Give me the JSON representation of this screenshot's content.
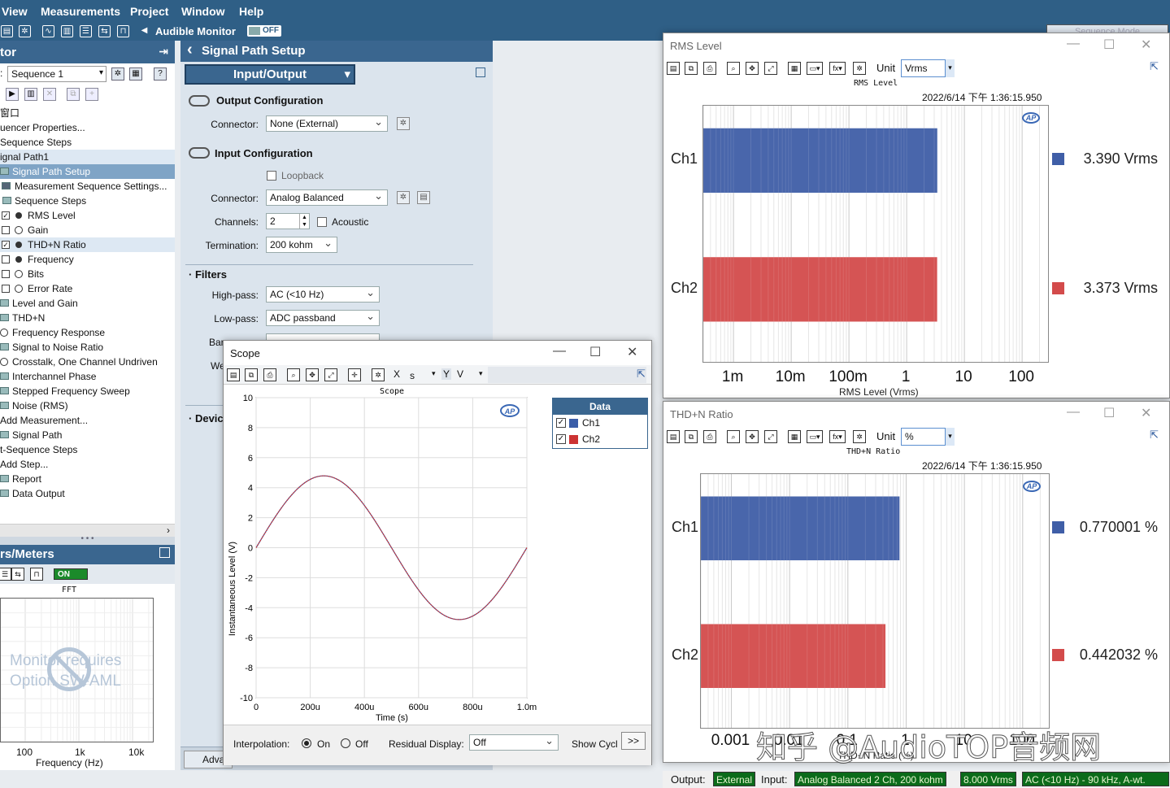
{
  "menu": [
    "View",
    "Measurements",
    "Project",
    "Window",
    "Help"
  ],
  "toolbar": {
    "audible_monitor": "Audible Monitor",
    "audible_state": "OFF",
    "sequence_mode": "Sequence Mode"
  },
  "navigator": {
    "title": "tor",
    "sequence": "Sequence 1",
    "tree": [
      {
        "text": "窗口",
        "indent": 0,
        "icon": "none"
      },
      {
        "text": "uencer Properties...",
        "indent": 0,
        "icon": "none"
      },
      {
        "text": "Sequence Steps",
        "indent": 0,
        "icon": "none"
      },
      {
        "text": "ignal Path1",
        "indent": 0,
        "icon": "none",
        "style": "sel"
      },
      {
        "text": "Signal Path Setup",
        "indent": 14,
        "icon": "fold",
        "style": "sel2"
      },
      {
        "text": "Measurement Sequence Settings...",
        "indent": 18,
        "icon": "gear"
      },
      {
        "text": "Sequence Steps",
        "indent": 18,
        "icon": "fold"
      },
      {
        "text": "RMS Level",
        "indent": 34,
        "icon": "chk-dot",
        "checked": true
      },
      {
        "text": "Gain",
        "indent": 34,
        "icon": "chk-ban"
      },
      {
        "text": "THD+N Ratio",
        "indent": 34,
        "icon": "chk-dot",
        "checked": true,
        "style": "sel"
      },
      {
        "text": "Frequency",
        "indent": 34,
        "icon": "chk-dot"
      },
      {
        "text": "Bits",
        "indent": 34,
        "icon": "chk-ban"
      },
      {
        "text": "Error Rate",
        "indent": 34,
        "icon": "chk-ban"
      },
      {
        "text": "Level and Gain",
        "indent": 15,
        "icon": "fold"
      },
      {
        "text": "THD+N",
        "indent": 15,
        "icon": "fold"
      },
      {
        "text": "Frequency Response",
        "indent": 15,
        "icon": "ban"
      },
      {
        "text": "Signal to Noise Ratio",
        "indent": 15,
        "icon": "fold"
      },
      {
        "text": "Crosstalk, One Channel Undriven",
        "indent": 15,
        "icon": "ban"
      },
      {
        "text": "Interchannel Phase",
        "indent": 15,
        "icon": "fold"
      },
      {
        "text": "Stepped Frequency Sweep",
        "indent": 15,
        "icon": "fold"
      },
      {
        "text": "Noise (RMS)",
        "indent": 15,
        "icon": "fold"
      },
      {
        "text": "Add Measurement...",
        "indent": 0,
        "icon": "none"
      },
      {
        "text": "Signal Path",
        "indent": 5,
        "icon": "fold"
      },
      {
        "text": "t-Sequence Steps",
        "indent": 0,
        "icon": "none"
      },
      {
        "text": "Add Step...",
        "indent": 0,
        "icon": "none"
      },
      {
        "text": "Report",
        "indent": 15,
        "icon": "fold"
      },
      {
        "text": "Data Output",
        "indent": 15,
        "icon": "fold"
      }
    ]
  },
  "meters": {
    "title": "rs/Meters",
    "state": "ON",
    "fft_title": "FFT",
    "message": "Monitor requires Option SW-AML",
    "x_ticks": [
      "100",
      "1k",
      "10k"
    ],
    "xlabel": "Frequency (Hz)"
  },
  "signal_path": {
    "title": "Signal Path Setup",
    "mode": "Input/Output",
    "output_config": "Output Configuration",
    "connector_label": "Connector:",
    "output_connector": "None (External)",
    "input_config": "Input Configuration",
    "loopback": "Loopback",
    "input_connector": "Analog Balanced",
    "channels_label": "Channels:",
    "channels": "2",
    "acoustic": "Acoustic",
    "termination_label": "Termination:",
    "termination": "200 kohm",
    "filters": "Filters",
    "highpass_label": "High-pass:",
    "highpass": "AC (<10 Hz)",
    "lowpass_label": "Low-pass:",
    "lowpass": "ADC passband",
    "bandwidth_label": "Bar",
    "bandwidth": "",
    "weighting_label": "We",
    "device": "Devic",
    "advanced": "Adva"
  },
  "scope": {
    "title": "Scope",
    "x_field": "X",
    "x_unit": "s",
    "y_field": "Y",
    "y_unit": "V",
    "legend_header": "Data",
    "interpolation_label": "Interpolation:",
    "interp_on": "On",
    "interp_off": "Off",
    "residual_label": "Residual Display:",
    "residual_value": "Off",
    "show_cycles": "Show Cycl",
    "more": ">>",
    "chart_data": {
      "type": "line",
      "title": "Scope",
      "xlabel": "Time (s)",
      "ylabel": "Instantaneous Level (V)",
      "xlim": [
        0,
        0.001
      ],
      "ylim": [
        -10,
        10
      ],
      "x_ticks": [
        "0",
        "200u",
        "400u",
        "600u",
        "800u",
        "1.0m"
      ],
      "y_ticks": [
        "10",
        "8",
        "6",
        "4",
        "2",
        "0",
        "-2",
        "-4",
        "-6",
        "-8",
        "-10"
      ],
      "waveform": {
        "amplitude": 4.79,
        "frequency_hz": 1000,
        "phase_deg": 0
      },
      "series": [
        {
          "name": "Ch1",
          "color": "#3a5da8"
        },
        {
          "name": "Ch2",
          "color": "#cc3333"
        }
      ]
    }
  },
  "rms_meter": {
    "window_title": "RMS Level",
    "unit_label": "Unit",
    "unit": "Vrms",
    "meter_title": "RMS Level",
    "timestamp": "2022/6/14 下午 1:36:15.950",
    "chart_data": {
      "type": "bar",
      "orientation": "horizontal",
      "title": "RMS Level",
      "xlabel": "RMS Level (Vrms)",
      "scale": "log",
      "xlim": [
        0.0003,
        300
      ],
      "x_ticks": [
        {
          "label": "1m",
          "value": 0.001
        },
        {
          "label": "10m",
          "value": 0.01
        },
        {
          "label": "100m",
          "value": 0.1
        },
        {
          "label": "1",
          "value": 1
        },
        {
          "label": "10",
          "value": 10
        },
        {
          "label": "100",
          "value": 100
        }
      ],
      "categories": [
        "Ch1",
        "Ch2"
      ],
      "values": [
        3.39,
        3.373
      ],
      "value_labels": [
        "3.390  Vrms",
        "3.373  Vrms"
      ],
      "colors": [
        "#3f5ea7",
        "#d34b4b"
      ]
    }
  },
  "thdn_meter": {
    "window_title": "THD+N Ratio",
    "unit_label": "Unit",
    "unit": "%",
    "meter_title": "THD+N Ratio",
    "timestamp": "2022/6/14 下午 1:36:15.950",
    "chart_data": {
      "type": "bar",
      "orientation": "horizontal",
      "title": "THD+N Ratio",
      "xlabel": "THD+N Ratio (%)",
      "scale": "log",
      "xlim": [
        0.0003,
        300
      ],
      "x_ticks": [
        {
          "label": "0.001",
          "value": 0.001
        },
        {
          "label": "0.01",
          "value": 0.01
        },
        {
          "label": "0.1",
          "value": 0.1
        },
        {
          "label": "1",
          "value": 1
        },
        {
          "label": "10",
          "value": 10
        },
        {
          "label": "100",
          "value": 100
        }
      ],
      "categories": [
        "Ch1",
        "Ch2"
      ],
      "values": [
        0.770001,
        0.442032
      ],
      "value_labels": [
        "0.770001  %",
        "0.442032  %"
      ],
      "colors": [
        "#3f5ea7",
        "#d34b4b"
      ]
    }
  },
  "status": {
    "output_label": "Output:",
    "output": "External",
    "input_label": "Input:",
    "input": "Analog Balanced 2 Ch, 200 kohm",
    "level": "8.000 Vrms",
    "filter": "AC (<10 Hz) - 90 kHz, A-wt."
  },
  "watermark": "知乎 @AudioTOP音频网"
}
